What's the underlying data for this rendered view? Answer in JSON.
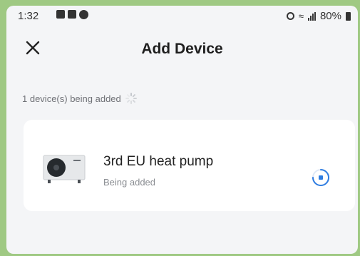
{
  "status_bar": {
    "time": "1:32",
    "battery": "80%"
  },
  "header": {
    "title": "Add Device",
    "close_icon": "close-icon"
  },
  "adding": {
    "status_text": "1 device(s) being added"
  },
  "device": {
    "name": "3rd EU heat pump",
    "state": "Being added"
  },
  "colors": {
    "frame": "#9fc983",
    "background": "#f4f5f7",
    "card": "#ffffff",
    "accent": "#2f7de1"
  }
}
